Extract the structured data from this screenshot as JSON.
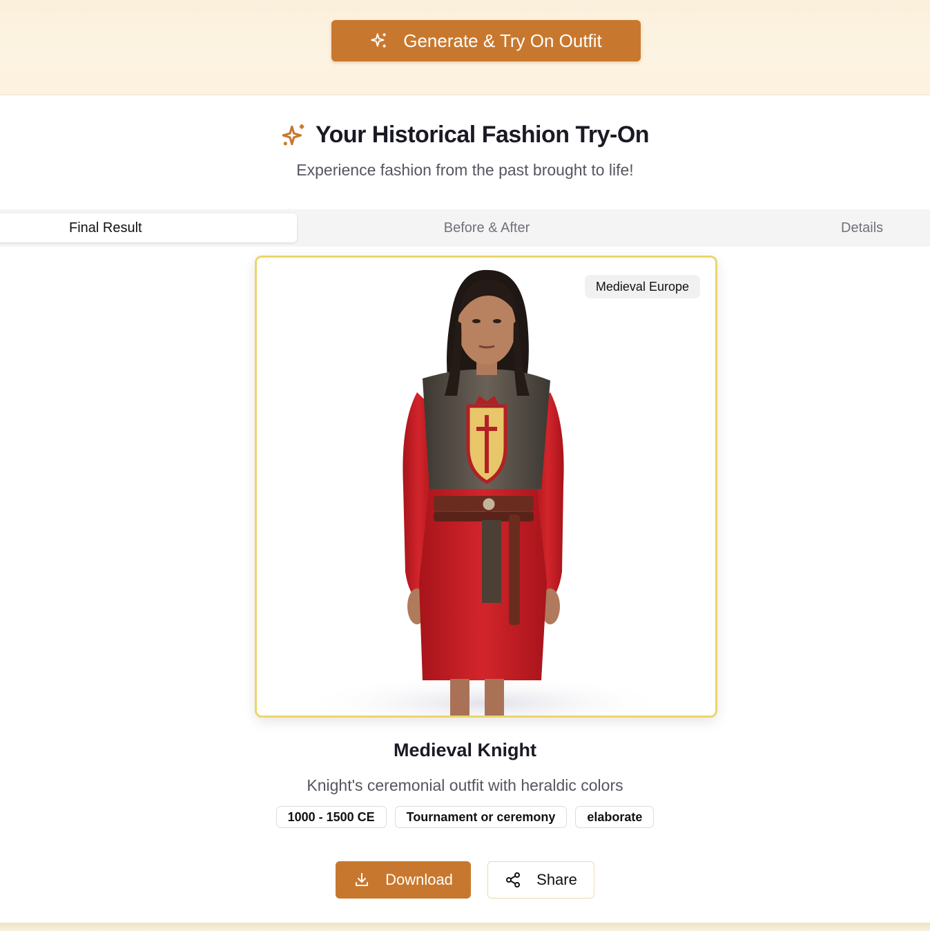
{
  "generate_button": {
    "label": "Generate & Try On Outfit",
    "icon": "sparkles-icon"
  },
  "header": {
    "title": "Your Historical Fashion Try-On",
    "subtitle": "Experience fashion from the past brought to life!",
    "icon": "sparkles-icon"
  },
  "tabs": [
    {
      "label": "Final Result",
      "active": true
    },
    {
      "label": "Before & After",
      "active": false
    },
    {
      "label": "Details",
      "active": false
    }
  ],
  "result": {
    "era_badge": "Medieval Europe",
    "image_description_icon": "person-figure",
    "outfit_name": "Medieval Knight",
    "outfit_description": "Knight's ceremonial outfit with heraldic colors",
    "tags": [
      "1000 - 1500 CE",
      "Tournament or ceremony",
      "elaborate"
    ]
  },
  "actions": {
    "download_label": "Download",
    "download_icon": "download-icon",
    "share_label": "Share",
    "share_icon": "share-icon"
  },
  "colors": {
    "accent": "#c8782e",
    "card_border": "#ecd56a",
    "cloth_red": "#c21f24"
  }
}
